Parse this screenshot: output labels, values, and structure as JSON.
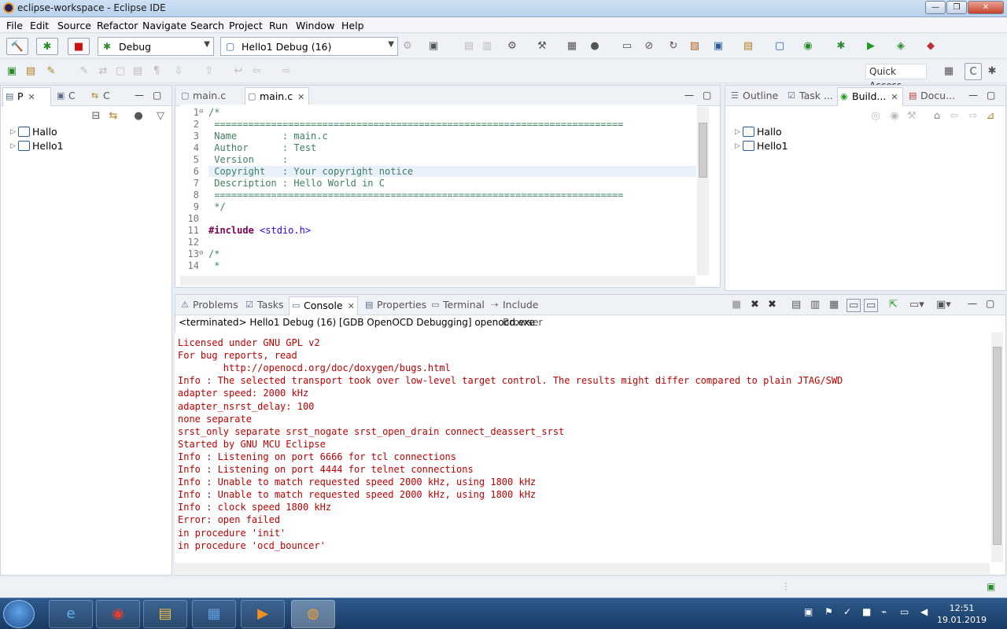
{
  "window": {
    "title": "eclipse-workspace - Eclipse IDE",
    "min": "—",
    "max": "❐",
    "close": "✕"
  },
  "menu": [
    "File",
    "Edit",
    "Source",
    "Refactor",
    "Navigate",
    "Search",
    "Project",
    "Run",
    "Window",
    "Help"
  ],
  "toolbar": {
    "launch_mode": "Debug",
    "launch_config": "Hello1 Debug (16)",
    "quick_access": "Quick Access"
  },
  "left_panel": {
    "tabs": [
      {
        "label": "P",
        "icon": "package-explorer-icon"
      },
      {
        "label": "C",
        "icon": "c-project-icon"
      },
      {
        "label": "C",
        "icon": "call-hierarchy-icon"
      }
    ],
    "projects": [
      "Hallo",
      "Hello1"
    ]
  },
  "editor": {
    "tabs": [
      {
        "label": "main.c",
        "active": false
      },
      {
        "label": "main.c",
        "active": true
      }
    ],
    "lines": [
      {
        "n": "1",
        "text": "/*",
        "fold": true
      },
      {
        "n": "2",
        "text": " ========================================================================"
      },
      {
        "n": "3",
        "text": " Name        : main.c"
      },
      {
        "n": "4",
        "text": " Author      : Test"
      },
      {
        "n": "5",
        "text": " Version     :"
      },
      {
        "n": "6",
        "text": " Copyright   : Your copyright notice",
        "highlight": true
      },
      {
        "n": "7",
        "text": " Description : Hello World in C"
      },
      {
        "n": "8",
        "text": " ========================================================================"
      },
      {
        "n": "9",
        "text": " */"
      },
      {
        "n": "10",
        "text": ""
      },
      {
        "n": "11",
        "text": "#include <stdio.h>",
        "include": true
      },
      {
        "n": "12",
        "text": ""
      },
      {
        "n": "13",
        "text": "/*",
        "fold": true
      },
      {
        "n": "14",
        "text": " *"
      }
    ]
  },
  "right_panel": {
    "tabs": [
      {
        "label": "Outline"
      },
      {
        "label": "Task ..."
      },
      {
        "label": "Build..."
      },
      {
        "label": "Docu..."
      }
    ],
    "projects": [
      "Hallo",
      "Hello1"
    ]
  },
  "console_panel": {
    "tabs": [
      {
        "label": "Problems"
      },
      {
        "label": "Tasks"
      },
      {
        "label": "Console"
      },
      {
        "label": "Properties"
      },
      {
        "label": "Terminal"
      },
      {
        "label": "Include Browser"
      }
    ],
    "header": "<terminated> Hello1 Debug (16) [GDB OpenOCD Debugging] openocd.exe",
    "lines": [
      "Licensed under GNU GPL v2",
      "For bug reports, read",
      "        http://openocd.org/doc/doxygen/bugs.html",
      "Info : The selected transport took over low-level target control. The results might differ compared to plain JTAG/SWD",
      "adapter speed: 2000 kHz",
      "adapter_nsrst_delay: 100",
      "none separate",
      "srst_only separate srst_nogate srst_open_drain connect_deassert_srst",
      "Started by GNU MCU Eclipse",
      "Info : Listening on port 6666 for tcl connections",
      "Info : Listening on port 4444 for telnet connections",
      "Info : Unable to match requested speed 2000 kHz, using 1800 kHz",
      "Info : Unable to match requested speed 2000 kHz, using 1800 kHz",
      "Info : clock speed 1800 kHz",
      "Error: open failed",
      "in procedure 'init'",
      "in procedure 'ocd_bouncer'"
    ]
  },
  "taskbar": {
    "time": "12:51",
    "date": "19.01.2019"
  }
}
